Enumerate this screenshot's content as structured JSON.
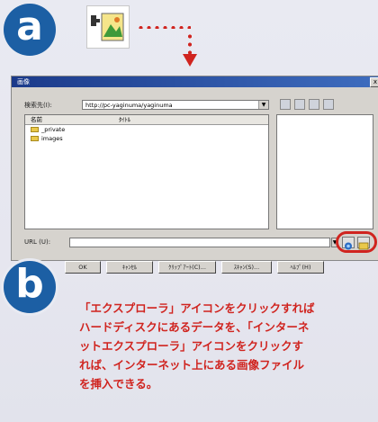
{
  "step_a": "a",
  "step_b": "b",
  "dialog": {
    "title": "画像",
    "close": "x",
    "lookin_label": "検索先(I):",
    "lookin_value": "http://pc-yaginuma/yaginuma",
    "columns": [
      "名前",
      "ﾀｲﾄﾙ"
    ],
    "items": [
      "_private",
      "images"
    ],
    "url_label": "URL (U):",
    "url_value": "",
    "buttons": [
      "OK",
      "ｷｬﾝｾﾙ",
      "ｸﾘｯﾌﾟｱｰﾄ(C)...",
      "ｽｷｬﾝ(S)...",
      "ﾍﾙﾌﾟ(H)"
    ]
  },
  "caption": "「エクスプローラ」アイコンをクリックすれば\nハードディスクにあるデータを、「インターネ\nットエクスプローラ」アイコンをクリックす\nれば、インターネット上にある画像ファイル\nを挿入できる。",
  "colors": {
    "accent_red": "#d0241f",
    "circle_blue": "#1c5fa4"
  }
}
